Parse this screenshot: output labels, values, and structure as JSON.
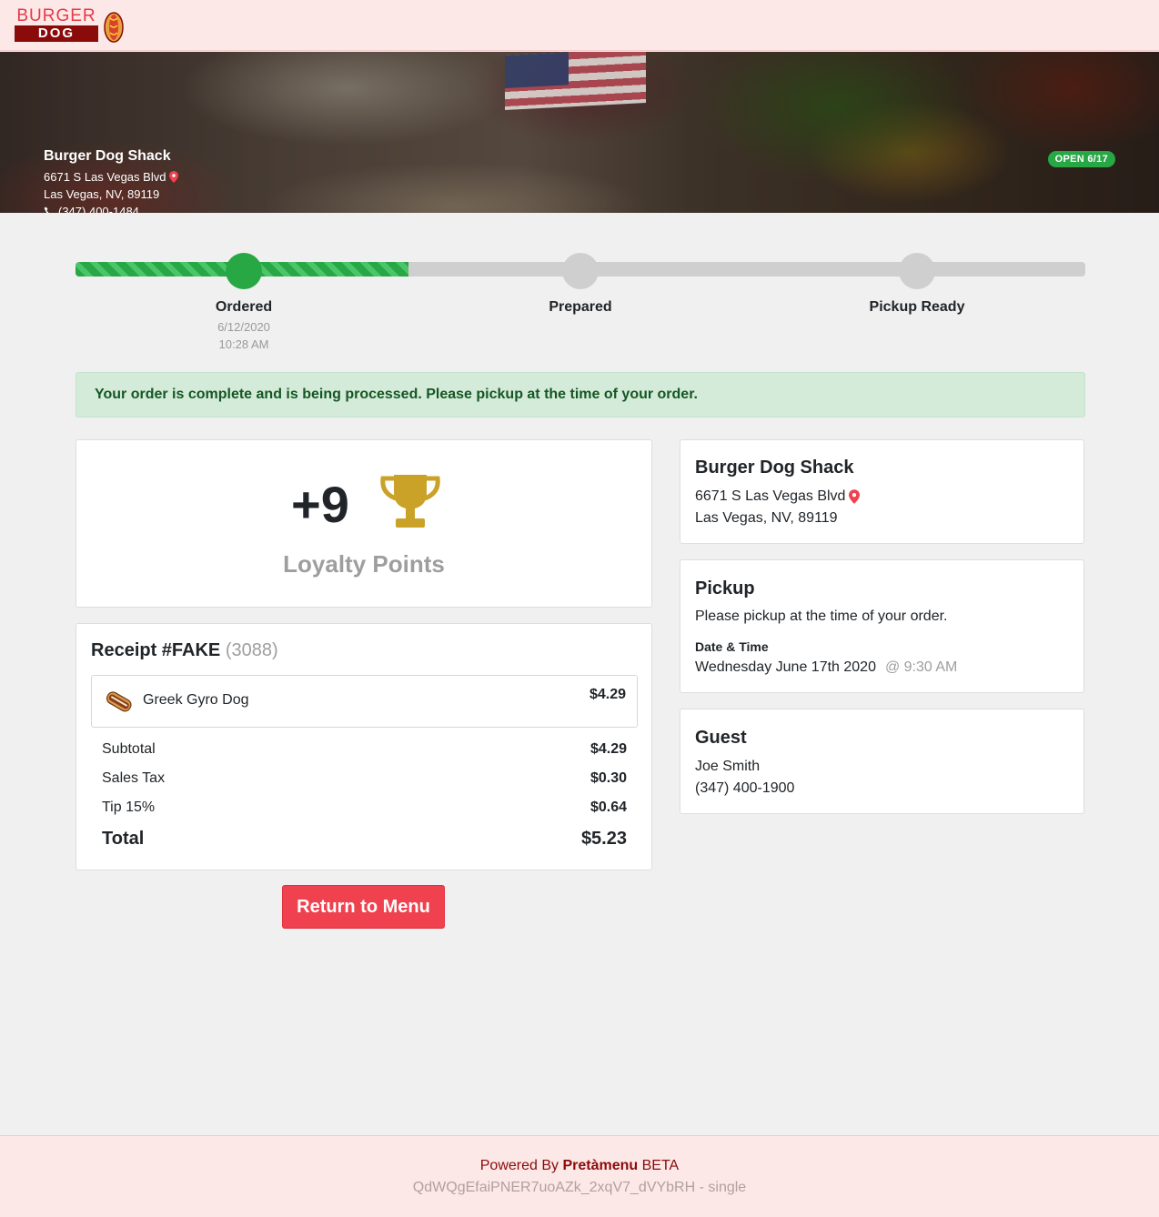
{
  "logo": {
    "top": "BURGER",
    "bottom": "DOG"
  },
  "hero": {
    "name": "Burger Dog Shack",
    "address1": "6671 S Las Vegas Blvd",
    "address2": "Las Vegas, NV, 89119",
    "phone": "(347) 400-1484",
    "badge": "OPEN 6/17"
  },
  "progress": {
    "fill_fraction": 0.33,
    "steps": [
      {
        "label": "Ordered",
        "date": "6/12/2020",
        "time": "10:28 AM",
        "done": true
      },
      {
        "label": "Prepared",
        "done": false
      },
      {
        "label": "Pickup Ready",
        "done": false
      }
    ]
  },
  "alert": "Your order is complete and is being processed. Please pickup at the time of your order.",
  "loyalty": {
    "points": "+9",
    "label": "Loyalty Points"
  },
  "receipt": {
    "title": "Receipt #FAKE",
    "number": "(3088)",
    "items": [
      {
        "name": "Greek Gyro Dog",
        "price": "$4.29"
      }
    ],
    "subtotal_label": "Subtotal",
    "subtotal": "$4.29",
    "tax_label": "Sales Tax",
    "tax": "$0.30",
    "tip_label": "Tip 15%",
    "tip": "$0.64",
    "total_label": "Total",
    "total": "$5.23"
  },
  "return_button": "Return to Menu",
  "location_card": {
    "title": "Burger Dog Shack",
    "address1": "6671 S Las Vegas Blvd",
    "address2": "Las Vegas, NV, 89119"
  },
  "pickup_card": {
    "title": "Pickup",
    "note": "Please pickup at the time of your order.",
    "datetime_label": "Date & Time",
    "date": "Wednesday June 17th 2020",
    "time": "@ 9:30 AM"
  },
  "guest_card": {
    "title": "Guest",
    "name": "Joe Smith",
    "phone": "(347) 400-1900"
  },
  "footer": {
    "powered_prefix": "Powered By",
    "brand": "Pretàmenu",
    "suffix": "BETA",
    "token": "QdWQgEfaiPNER7uoAZk_2xqV7_dVYbRH - single"
  },
  "colors": {
    "accent": "#f0414e",
    "success": "#28a745",
    "brand_dark": "#8b0a0a",
    "trophy": "#c9a227"
  }
}
